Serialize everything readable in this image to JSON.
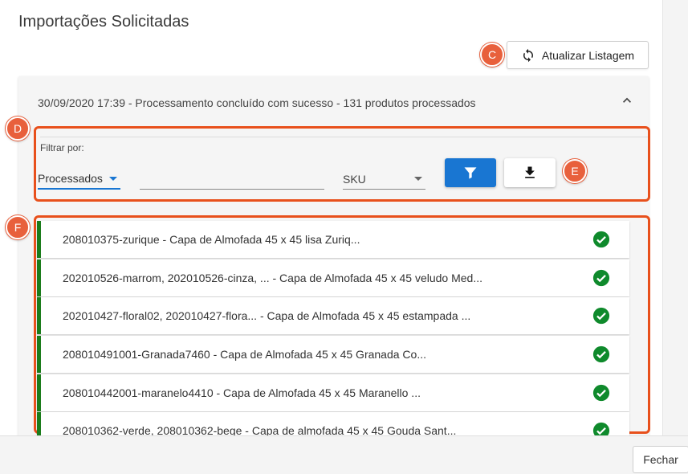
{
  "page": {
    "title": "Importações Solicitadas"
  },
  "toolbar": {
    "refresh_label": "Atualizar Listagem"
  },
  "markers": {
    "c": "C",
    "d": "D",
    "e": "E",
    "f": "F"
  },
  "import": {
    "summary": "30/09/2020 17:39 - Processamento concluído com sucesso - 131 produtos processados"
  },
  "filter": {
    "label": "Filtrar por:",
    "status_selected": "Processados",
    "search_value": "",
    "field_selected": "SKU"
  },
  "items": [
    {
      "text": "208010375-zurique - Capa de Almofada 45 x 45 lisa Zuriq...",
      "status": "success"
    },
    {
      "text": "202010526-marrom, 202010526-cinza, ... - Capa de Almofada 45 x 45 veludo Med...",
      "status": "success"
    },
    {
      "text": "202010427-floral02, 202010427-flora... - Capa de Almofada 45 x 45 estampada ...",
      "status": "success"
    },
    {
      "text": "208010491001-Granada7460 - Capa de Almofada 45 x 45 Granada Co...",
      "status": "success"
    },
    {
      "text": "208010442001-maranelo4410 - Capa de Almofada 45 x 45 Maranello ...",
      "status": "success"
    },
    {
      "text": "208010362-verde, 208010362-bege - Capa de almofada 45 x 45 Gouda Sant...",
      "status": "success"
    }
  ],
  "footer": {
    "close_label": "Fechar"
  },
  "colors": {
    "primary": "#1976d2",
    "success": "#0f8a2c",
    "highlight": "#e8501c",
    "item_border": "#1b7c1b"
  }
}
